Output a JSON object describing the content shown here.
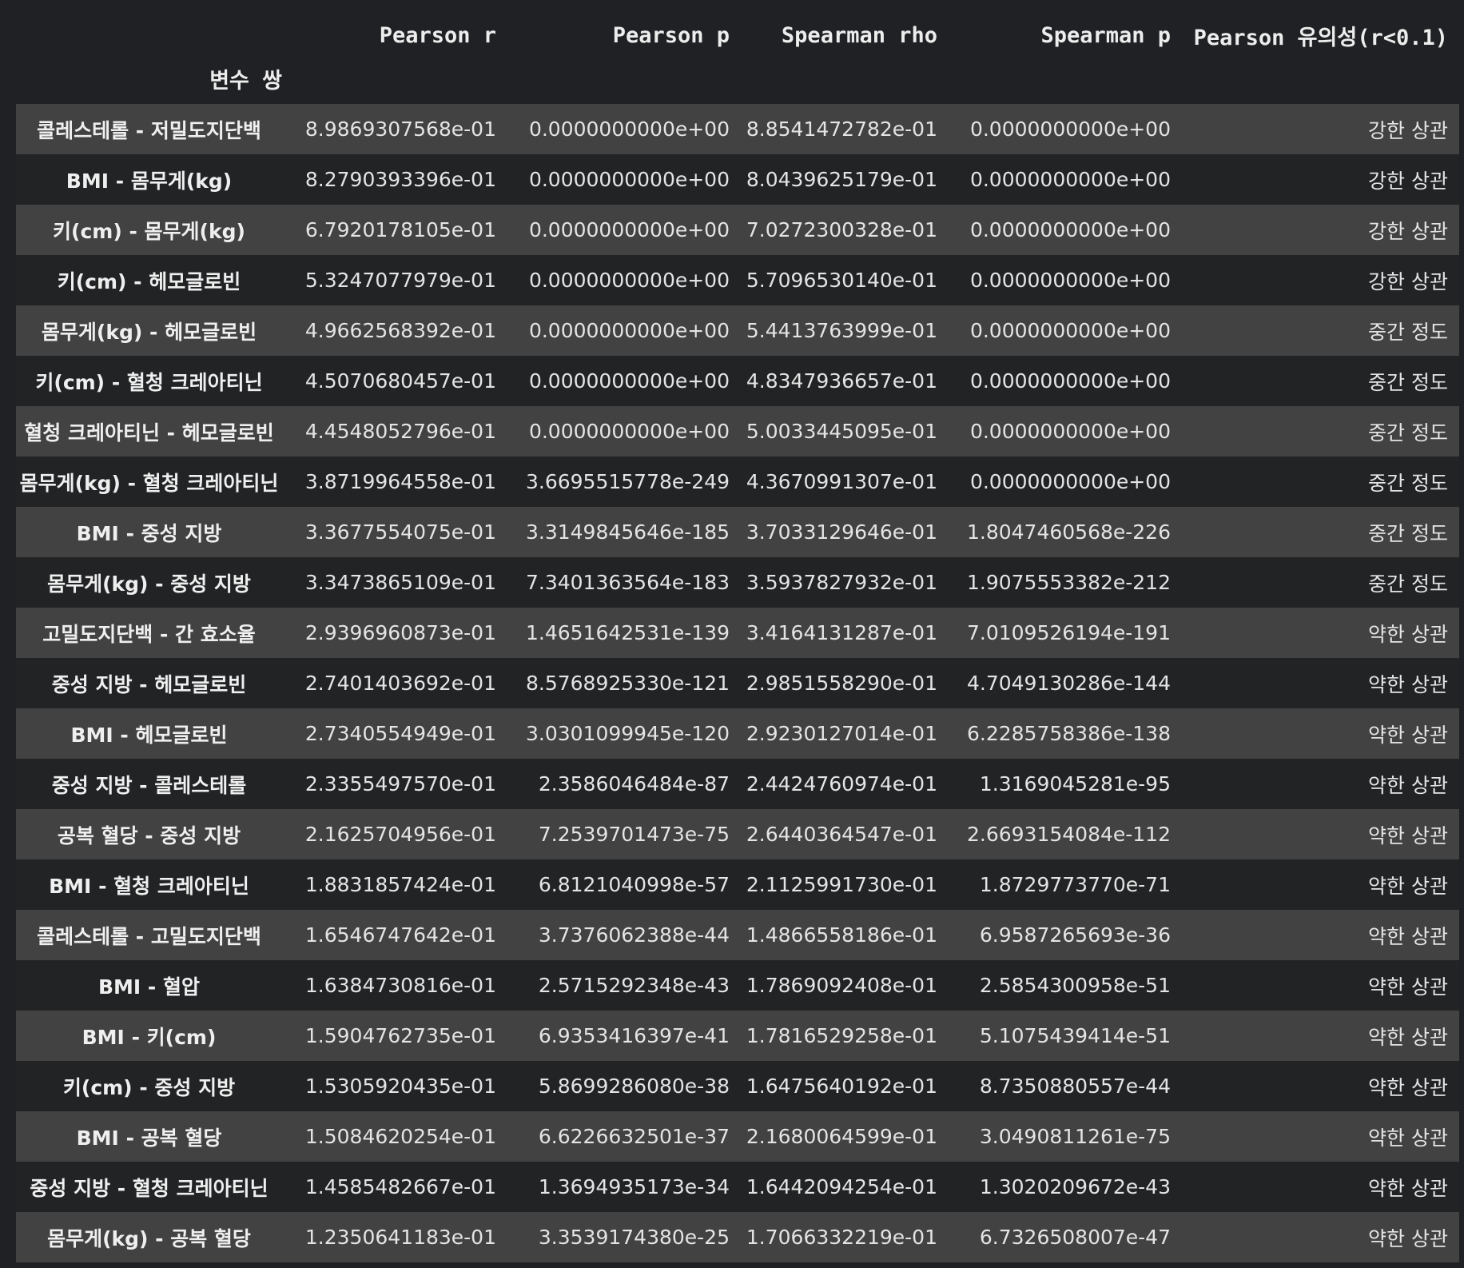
{
  "table": {
    "columns": [
      "Pearson r",
      "Pearson p",
      "Spearman rho",
      "Spearman p",
      "Pearson 유의성(r<0.1)"
    ],
    "index_name": "변수 쌍",
    "rows": [
      [
        "콜레스테롤 - 저밀도지단백",
        "8.9869307568e-01",
        "0.0000000000e+00",
        "8.8541472782e-01",
        "0.0000000000e+00",
        "강한 상관"
      ],
      [
        "BMI - 몸무게(kg)",
        "8.2790393396e-01",
        "0.0000000000e+00",
        "8.0439625179e-01",
        "0.0000000000e+00",
        "강한 상관"
      ],
      [
        "키(cm) - 몸무게(kg)",
        "6.7920178105e-01",
        "0.0000000000e+00",
        "7.0272300328e-01",
        "0.0000000000e+00",
        "강한 상관"
      ],
      [
        "키(cm) - 헤모글로빈",
        "5.3247077979e-01",
        "0.0000000000e+00",
        "5.7096530140e-01",
        "0.0000000000e+00",
        "강한 상관"
      ],
      [
        "몸무게(kg) - 헤모글로빈",
        "4.9662568392e-01",
        "0.0000000000e+00",
        "5.4413763999e-01",
        "0.0000000000e+00",
        "중간 정도"
      ],
      [
        "키(cm) - 혈청 크레아티닌",
        "4.5070680457e-01",
        "0.0000000000e+00",
        "4.8347936657e-01",
        "0.0000000000e+00",
        "중간 정도"
      ],
      [
        "혈청 크레아티닌 - 헤모글로빈",
        "4.4548052796e-01",
        "0.0000000000e+00",
        "5.0033445095e-01",
        "0.0000000000e+00",
        "중간 정도"
      ],
      [
        "몸무게(kg) - 혈청 크레아티닌",
        "3.8719964558e-01",
        "3.6695515778e-249",
        "4.3670991307e-01",
        "0.0000000000e+00",
        "중간 정도"
      ],
      [
        "BMI - 중성 지방",
        "3.3677554075e-01",
        "3.3149845646e-185",
        "3.7033129646e-01",
        "1.8047460568e-226",
        "중간 정도"
      ],
      [
        "몸무게(kg) - 중성 지방",
        "3.3473865109e-01",
        "7.3401363564e-183",
        "3.5937827932e-01",
        "1.9075553382e-212",
        "중간 정도"
      ],
      [
        "고밀도지단백 - 간 효소율",
        "2.9396960873e-01",
        "1.4651642531e-139",
        "3.4164131287e-01",
        "7.0109526194e-191",
        "약한 상관"
      ],
      [
        "중성 지방 - 헤모글로빈",
        "2.7401403692e-01",
        "8.5768925330e-121",
        "2.9851558290e-01",
        "4.7049130286e-144",
        "약한 상관"
      ],
      [
        "BMI - 헤모글로빈",
        "2.7340554949e-01",
        "3.0301099945e-120",
        "2.9230127014e-01",
        "6.2285758386e-138",
        "약한 상관"
      ],
      [
        "중성 지방 - 콜레스테롤",
        "2.3355497570e-01",
        "2.3586046484e-87",
        "2.4424760974e-01",
        "1.3169045281e-95",
        "약한 상관"
      ],
      [
        "공복 혈당 - 중성 지방",
        "2.1625704956e-01",
        "7.2539701473e-75",
        "2.6440364547e-01",
        "2.6693154084e-112",
        "약한 상관"
      ],
      [
        "BMI - 혈청 크레아티닌",
        "1.8831857424e-01",
        "6.8121040998e-57",
        "2.1125991730e-01",
        "1.8729773770e-71",
        "약한 상관"
      ],
      [
        "콜레스테롤 - 고밀도지단백",
        "1.6546747642e-01",
        "3.7376062388e-44",
        "1.4866558186e-01",
        "6.9587265693e-36",
        "약한 상관"
      ],
      [
        "BMI - 혈압",
        "1.6384730816e-01",
        "2.5715292348e-43",
        "1.7869092408e-01",
        "2.5854300958e-51",
        "약한 상관"
      ],
      [
        "BMI - 키(cm)",
        "1.5904762735e-01",
        "6.9353416397e-41",
        "1.7816529258e-01",
        "5.1075439414e-51",
        "약한 상관"
      ],
      [
        "키(cm) - 중성 지방",
        "1.5305920435e-01",
        "5.8699286080e-38",
        "1.6475640192e-01",
        "8.7350880557e-44",
        "약한 상관"
      ],
      [
        "BMI - 공복 혈당",
        "1.5084620254e-01",
        "6.6226632501e-37",
        "2.1680064599e-01",
        "3.0490811261e-75",
        "약한 상관"
      ],
      [
        "중성 지방 - 혈청 크레아티닌",
        "1.4585482667e-01",
        "1.3694935173e-34",
        "1.6442094254e-01",
        "1.3020209672e-43",
        "약한 상관"
      ],
      [
        "몸무게(kg) - 공복 혈당",
        "1.2350641183e-01",
        "3.3539174380e-25",
        "1.7066332219e-01",
        "6.7326508007e-47",
        "약한 상관"
      ]
    ]
  }
}
